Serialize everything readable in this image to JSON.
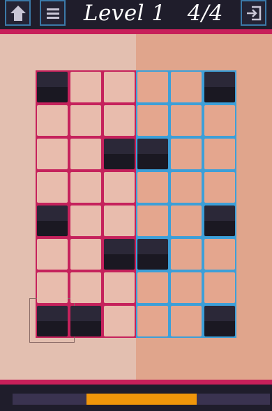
{
  "header": {
    "title": "Level 1   4/4",
    "buttons": [
      {
        "name": "home",
        "icon": "home-icon"
      },
      {
        "name": "menu",
        "icon": "menu-icon"
      },
      {
        "name": "exit",
        "icon": "exit-icon"
      }
    ]
  },
  "board": {
    "columns": 6,
    "rows": 8,
    "left_zone_color": "#e3bfb0",
    "right_zone_color": "#e0a58c",
    "left_border_color": "#c5225c",
    "right_border_color": "#3d9fd8",
    "dark_tile_color": "#1d1a26",
    "dark_cells": [
      [
        0,
        0
      ],
      [
        0,
        5
      ],
      [
        2,
        2
      ],
      [
        2,
        3
      ],
      [
        4,
        0
      ],
      [
        4,
        5
      ],
      [
        5,
        2
      ],
      [
        5,
        3
      ],
      [
        7,
        0
      ],
      [
        7,
        1
      ],
      [
        7,
        5
      ]
    ],
    "cursor_icon": "pointer-cursor-icon"
  },
  "progress": {
    "start_fraction": 0.287,
    "end_fraction": 0.715,
    "fill_color": "#f0960a",
    "track_color": "#3a3350"
  }
}
